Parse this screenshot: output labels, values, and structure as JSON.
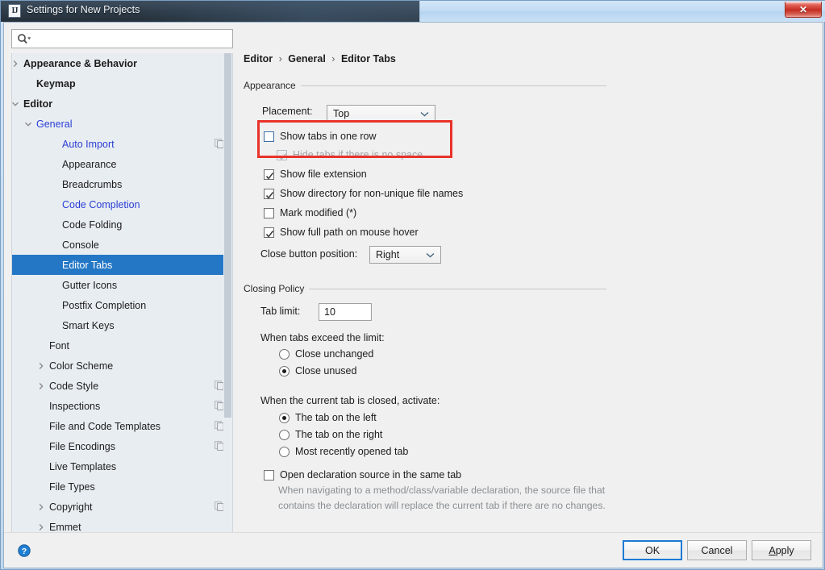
{
  "window": {
    "title": "Settings for New Projects",
    "app_icon": "intellij-idea-icon",
    "close_label": "✕"
  },
  "search": {
    "placeholder": "",
    "value": "",
    "icon": "search-icon"
  },
  "sidebar": {
    "items": [
      {
        "label": "Appearance & Behavior",
        "indent": 0,
        "arrow": "right",
        "bold": true,
        "blue": false,
        "selected": false,
        "copy": false
      },
      {
        "label": "Keymap",
        "indent": 1,
        "arrow": "none",
        "bold": true,
        "blue": false,
        "selected": false,
        "copy": false
      },
      {
        "label": "Editor",
        "indent": 0,
        "arrow": "down",
        "bold": true,
        "blue": false,
        "selected": false,
        "copy": false
      },
      {
        "label": "General",
        "indent": 1,
        "arrow": "down",
        "bold": false,
        "blue": true,
        "selected": false,
        "copy": false
      },
      {
        "label": "Auto Import",
        "indent": 3,
        "arrow": "none",
        "bold": false,
        "blue": true,
        "selected": false,
        "copy": true
      },
      {
        "label": "Appearance",
        "indent": 3,
        "arrow": "none",
        "bold": false,
        "blue": false,
        "selected": false,
        "copy": false
      },
      {
        "label": "Breadcrumbs",
        "indent": 3,
        "arrow": "none",
        "bold": false,
        "blue": false,
        "selected": false,
        "copy": false
      },
      {
        "label": "Code Completion",
        "indent": 3,
        "arrow": "none",
        "bold": false,
        "blue": true,
        "selected": false,
        "copy": false
      },
      {
        "label": "Code Folding",
        "indent": 3,
        "arrow": "none",
        "bold": false,
        "blue": false,
        "selected": false,
        "copy": false
      },
      {
        "label": "Console",
        "indent": 3,
        "arrow": "none",
        "bold": false,
        "blue": false,
        "selected": false,
        "copy": false
      },
      {
        "label": "Editor Tabs",
        "indent": 3,
        "arrow": "none",
        "bold": false,
        "blue": true,
        "selected": true,
        "copy": false
      },
      {
        "label": "Gutter Icons",
        "indent": 3,
        "arrow": "none",
        "bold": false,
        "blue": false,
        "selected": false,
        "copy": false
      },
      {
        "label": "Postfix Completion",
        "indent": 3,
        "arrow": "none",
        "bold": false,
        "blue": false,
        "selected": false,
        "copy": false
      },
      {
        "label": "Smart Keys",
        "indent": 3,
        "arrow": "none",
        "bold": false,
        "blue": false,
        "selected": false,
        "copy": false
      },
      {
        "label": "Font",
        "indent": 2,
        "arrow": "none",
        "bold": false,
        "blue": false,
        "selected": false,
        "copy": false
      },
      {
        "label": "Color Scheme",
        "indent": 2,
        "arrow": "right",
        "bold": false,
        "blue": false,
        "selected": false,
        "copy": false
      },
      {
        "label": "Code Style",
        "indent": 2,
        "arrow": "right",
        "bold": false,
        "blue": false,
        "selected": false,
        "copy": true
      },
      {
        "label": "Inspections",
        "indent": 2,
        "arrow": "none",
        "bold": false,
        "blue": false,
        "selected": false,
        "copy": true
      },
      {
        "label": "File and Code Templates",
        "indent": 2,
        "arrow": "none",
        "bold": false,
        "blue": false,
        "selected": false,
        "copy": true
      },
      {
        "label": "File Encodings",
        "indent": 2,
        "arrow": "none",
        "bold": false,
        "blue": false,
        "selected": false,
        "copy": true
      },
      {
        "label": "Live Templates",
        "indent": 2,
        "arrow": "none",
        "bold": false,
        "blue": false,
        "selected": false,
        "copy": false
      },
      {
        "label": "File Types",
        "indent": 2,
        "arrow": "none",
        "bold": false,
        "blue": false,
        "selected": false,
        "copy": false
      },
      {
        "label": "Copyright",
        "indent": 2,
        "arrow": "right",
        "bold": false,
        "blue": false,
        "selected": false,
        "copy": true
      },
      {
        "label": "Emmet",
        "indent": 2,
        "arrow": "right",
        "bold": false,
        "blue": false,
        "selected": false,
        "copy": false
      }
    ]
  },
  "breadcrumb": {
    "part1": "Editor",
    "part2": "General",
    "part3": "Editor Tabs",
    "separator": "›"
  },
  "appearance": {
    "section_title": "Appearance",
    "placement_label": "Placement:",
    "placement_value": "Top",
    "show_tabs_one_row": "Show tabs in one row",
    "hide_tabs_no_space": "Hide tabs if there is no space",
    "show_file_extension": "Show file extension",
    "show_directory_non_unique": "Show directory for non-unique file names",
    "mark_modified": "Mark modified (*)",
    "show_full_path": "Show full path on mouse hover",
    "close_button_position_label": "Close button position:",
    "close_button_position_value": "Right"
  },
  "closing_policy": {
    "section_title": "Closing Policy",
    "tab_limit_label": "Tab limit:",
    "tab_limit_value": "10",
    "exceed_label": "When tabs exceed the limit:",
    "exceed_option_1": "Close unchanged",
    "exceed_option_2": "Close unused",
    "activate_label": "When the current tab is closed, activate:",
    "activate_option_1": "The tab on the left",
    "activate_option_2": "The tab on the right",
    "activate_option_3": "Most recently opened tab",
    "open_declaration_label": "Open declaration source in the same tab",
    "open_declaration_desc": "When navigating to a method/class/variable declaration, the source file that contains the declaration will replace the current tab if there are no changes."
  },
  "buttons": {
    "ok": "OK",
    "cancel": "Cancel",
    "apply_mnemonic": "A",
    "apply_rest": "pply",
    "help_icon": "help-icon"
  },
  "colors": {
    "selection_blue": "#2477c5",
    "link_blue": "#2b3fd4",
    "annotation_red": "#e8332a",
    "focus_blue": "#1e7ad4"
  }
}
